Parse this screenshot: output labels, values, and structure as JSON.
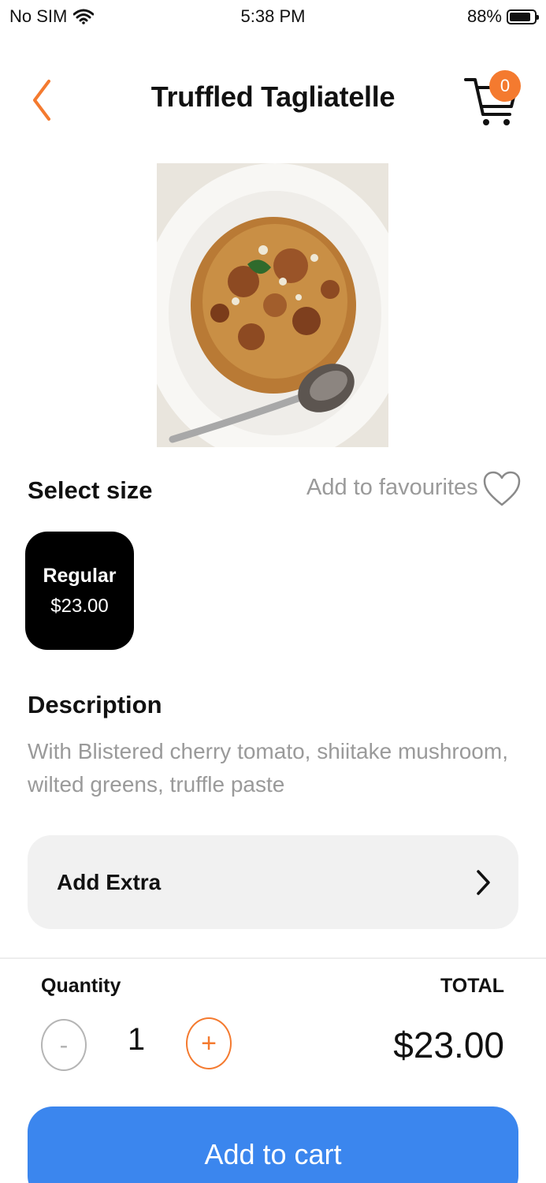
{
  "status_bar": {
    "carrier": "No SIM",
    "time": "5:38 PM",
    "battery": "88%",
    "battery_level": 0.88
  },
  "header": {
    "title": "Truffled Tagliatelle",
    "cart_count": "0",
    "back_icon": "chevron-left-icon",
    "cart_icon": "shopping-cart-icon",
    "accent_color": "#f47a2f"
  },
  "product": {
    "image_alt": "pasta dish photo"
  },
  "size_section": {
    "heading": "Select size",
    "favourites_label": "Add to favourites",
    "favourite_icon": "heart-outline-icon",
    "options": [
      {
        "name": "Regular",
        "price": "$23.00",
        "selected": true
      }
    ]
  },
  "description": {
    "heading": "Description",
    "text": "With Blistered cherry tomato, shiitake mushroom, wilted greens, truffle paste"
  },
  "extras": {
    "label": "Add Extra",
    "icon": "chevron-right-icon"
  },
  "order": {
    "quantity_label": "Quantity",
    "total_label": "TOTAL",
    "quantity": "1",
    "minus_label": "-",
    "plus_label": "+",
    "total": "$23.00",
    "add_to_cart_label": "Add to cart",
    "button_color": "#3b86ee"
  }
}
